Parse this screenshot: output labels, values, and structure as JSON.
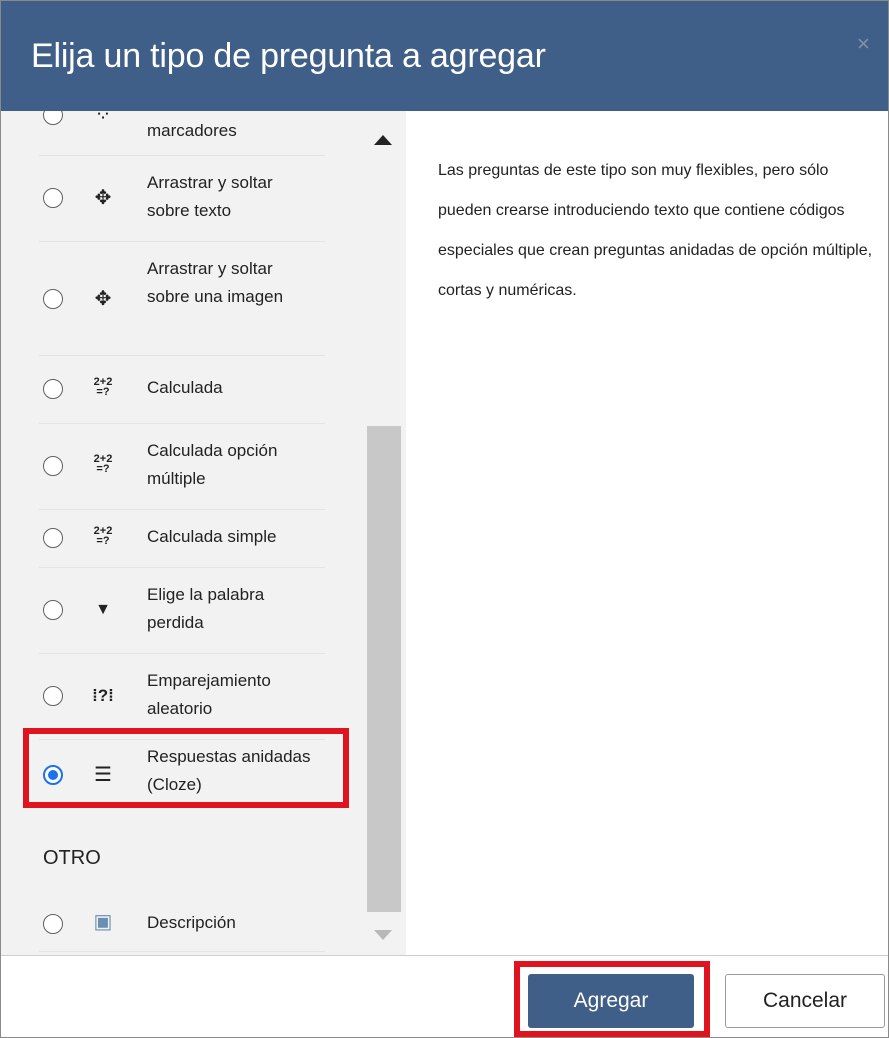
{
  "dialog": {
    "title": "Elija un tipo de pregunta a agregar",
    "close_symbol": "×"
  },
  "question_types": [
    {
      "label": "marcadores",
      "icon": "drag-drop-markers-icon",
      "icon_glyph": "⁘",
      "selected": false
    },
    {
      "label": "Arrastrar y soltar sobre texto",
      "icon": "drag-drop-text-icon",
      "icon_glyph": "✥",
      "selected": false
    },
    {
      "label": "Arrastrar y soltar sobre una imagen",
      "icon": "drag-drop-image-icon",
      "icon_glyph": "✥",
      "selected": false
    },
    {
      "label": "Calculada",
      "icon": "calculated-icon",
      "icon_glyph": "2+2 =?",
      "selected": false
    },
    {
      "label": "Calculada opción múltiple",
      "icon": "calculated-multichoice-icon",
      "icon_glyph": "2+2 =?",
      "selected": false
    },
    {
      "label": "Calculada simple",
      "icon": "calculated-simple-icon",
      "icon_glyph": "2+2 =?",
      "selected": false
    },
    {
      "label": "Elige la palabra perdida",
      "icon": "select-missing-word-icon",
      "icon_glyph": "▼",
      "selected": false
    },
    {
      "label": "Emparejamiento aleatorio",
      "icon": "random-matching-icon",
      "icon_glyph": "⁞?⁞",
      "selected": false
    },
    {
      "label": "Respuestas anidadas (Cloze)",
      "icon": "cloze-icon",
      "icon_glyph": "☰",
      "selected": true
    }
  ],
  "other_section": {
    "heading": "OTRO",
    "items": [
      {
        "label": "Descripción",
        "icon": "description-icon",
        "icon_glyph": "▣",
        "selected": false
      }
    ]
  },
  "description": "Las preguntas de este tipo son muy flexibles, pero sólo pueden crearse introduciendo texto que contiene códigos especiales que crean preguntas anidadas de opción múltiple, cortas y numéricas.",
  "buttons": {
    "add": "Agregar",
    "cancel": "Cancelar"
  },
  "colors": {
    "header": "#3f5f88",
    "primary_button": "#3f5f88",
    "radio_selected": "#1a73e8",
    "highlight": "#e0141e"
  }
}
